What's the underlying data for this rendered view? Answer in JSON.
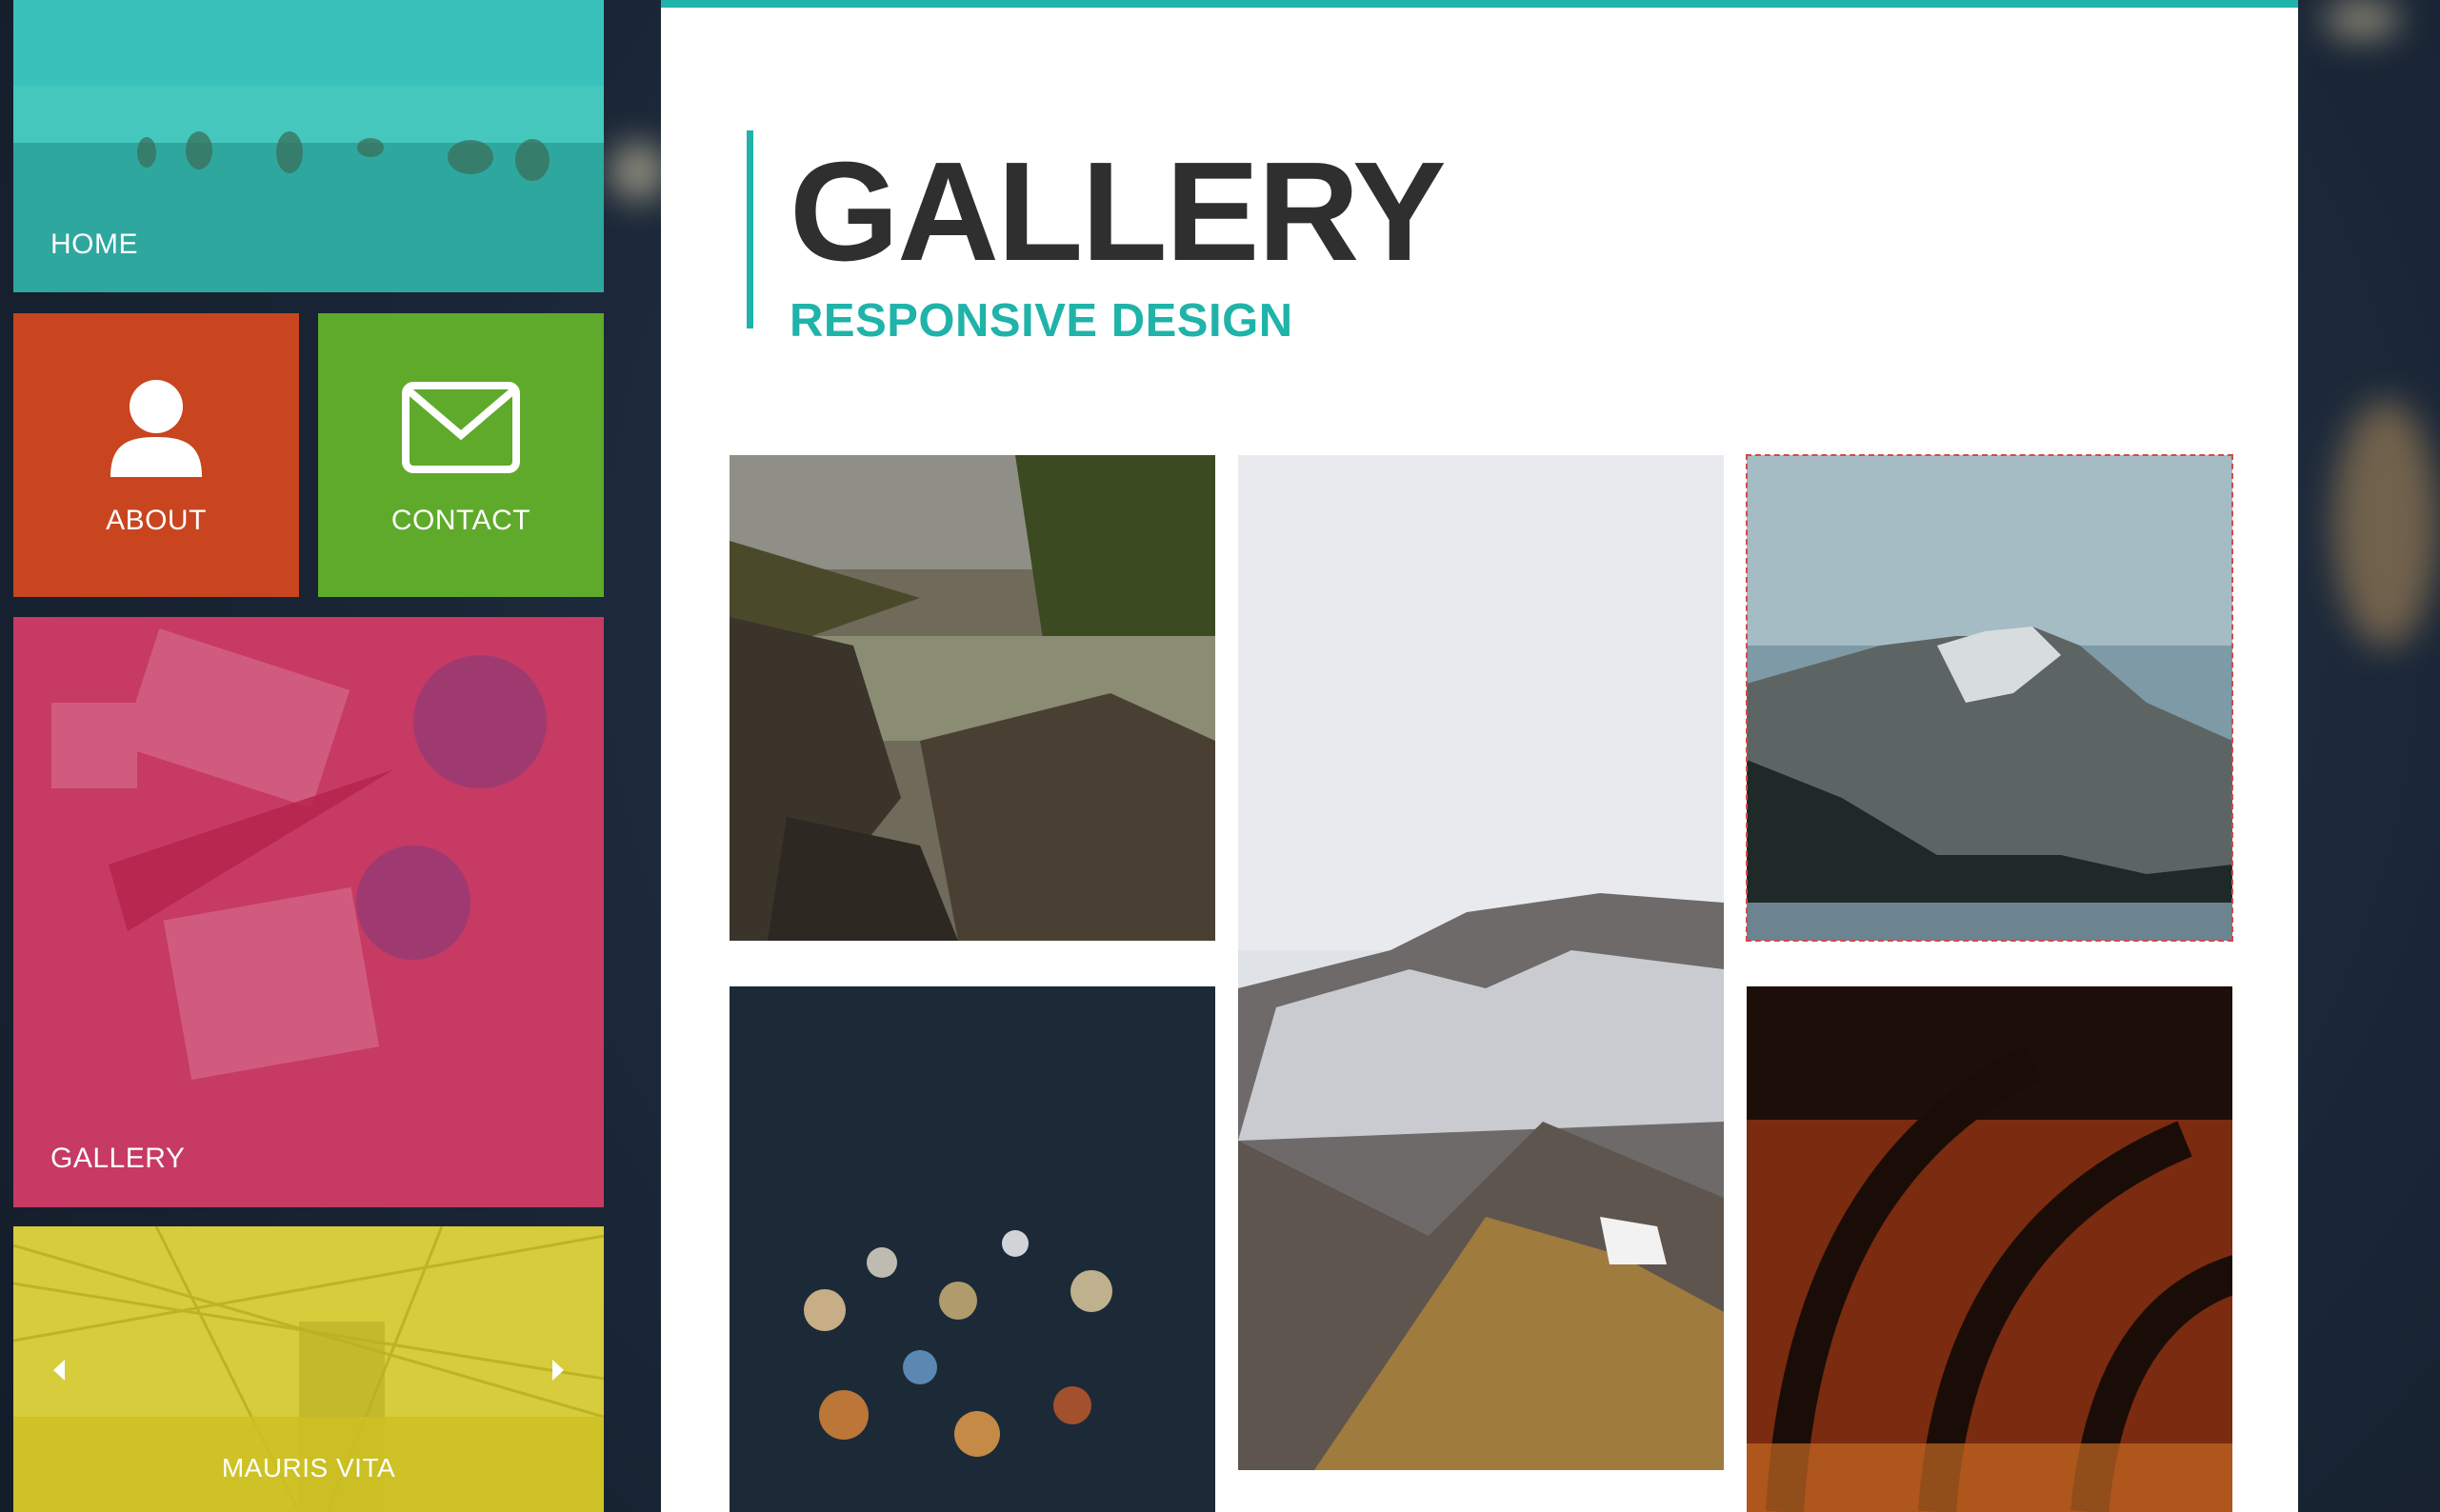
{
  "nav": {
    "home": {
      "label": "HOME",
      "color": "#2fb9b3"
    },
    "about": {
      "label": "ABOUT",
      "color": "#c8451f",
      "icon": "user-icon"
    },
    "contact": {
      "label": "CONTACT",
      "color": "#5faa2a",
      "icon": "envelope-icon"
    },
    "gallery": {
      "label": "GALLERY",
      "color": "#c42d5a"
    },
    "slider": {
      "label": "MAURIS VITA",
      "color": "#d4c82a",
      "prev_icon": "arrow-left-icon",
      "next_icon": "arrow-right-icon"
    }
  },
  "page": {
    "title": "GALLERY",
    "subtitle": "RESPONSIVE DESIGN",
    "accent": "#1fb3a9"
  },
  "gallery": {
    "photos": [
      {
        "name": "river-rocks"
      },
      {
        "name": "snowy-mountain-ridge"
      },
      {
        "name": "mountain-lake"
      },
      {
        "name": "city-lights-bokeh"
      },
      {
        "name": "vaulted-arches"
      }
    ]
  }
}
